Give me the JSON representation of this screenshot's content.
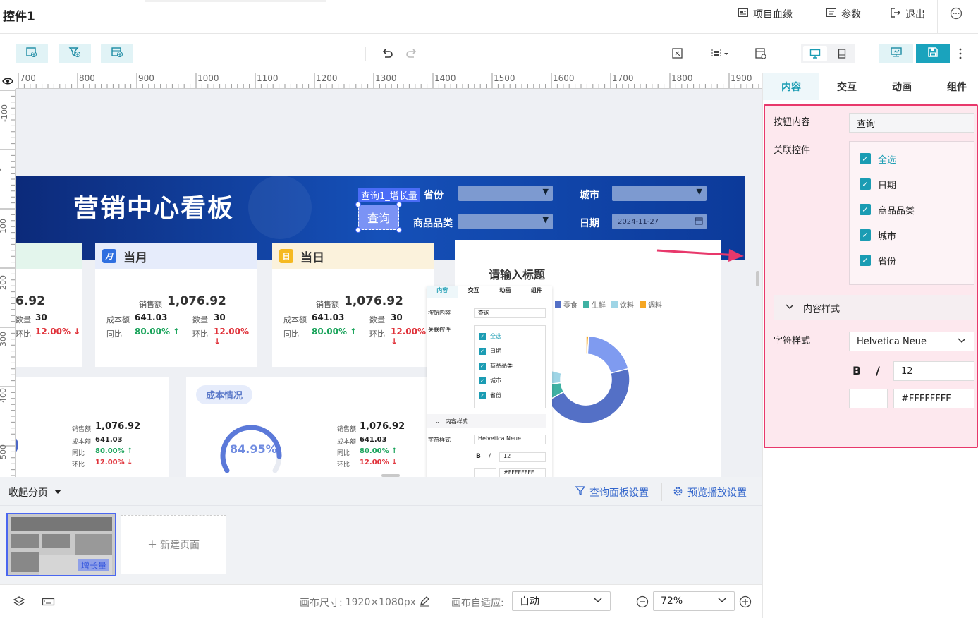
{
  "app": {
    "title": "控件1",
    "actions": {
      "lineage": "项目血缘",
      "params": "参数",
      "exit": "退出"
    }
  },
  "ruler": {
    "top": [
      "700",
      "800",
      "900",
      "1000",
      "1100",
      "1200",
      "1300",
      "1400",
      "1500",
      "1600",
      "1700",
      "1800",
      "1900"
    ],
    "left": [
      "-100",
      "0",
      "100",
      "200",
      "300",
      "400",
      "500"
    ]
  },
  "dashboard": {
    "title": "营销中心看板",
    "selection_label": "查询1_增长量",
    "query_button": "查询",
    "filters": {
      "province": "省份",
      "city": "城市",
      "category": "商品品类",
      "date": "日期",
      "date_value": "2024-11-27"
    },
    "card_partial": {
      "sales": "6.92",
      "qty_label": "数量",
      "qty": "30",
      "hb_label": "环比",
      "hb": "12.00%"
    },
    "card_month": {
      "title": "当月",
      "icon": "月",
      "sales_label": "销售额",
      "sales": "1,076.92",
      "cost_label": "成本额",
      "cost": "641.03",
      "qty_label": "数量",
      "qty": "30",
      "tb_label": "同比",
      "tb": "80.00%",
      "hb_label": "环比",
      "hb": "12.00%"
    },
    "card_day": {
      "title": "当日",
      "icon": "日",
      "sales_label": "销售额",
      "sales": "1,076.92",
      "cost_label": "成本额",
      "cost": "641.03",
      "qty_label": "数量",
      "qty": "30",
      "tb_label": "同比",
      "tb": "80.00%",
      "hb_label": "环比",
      "hb": "12.00%"
    },
    "small_left": {
      "sales_label": "销售额",
      "sales": "1,076.92",
      "cost_label": "成本额",
      "cost": "641.03",
      "tb_label": "同比",
      "tb": "80.00%",
      "hb_label": "环比",
      "hb": "12.00%"
    },
    "cost_card": {
      "badge": "成本情况",
      "gauge": "84.95%",
      "sales_label": "销售额",
      "sales": "1,076.92",
      "cost_label": "成本额",
      "cost": "641.03",
      "tb_label": "同比",
      "tb": "80.00%",
      "hb_label": "环比",
      "hb": "12.00%"
    },
    "chart_card": {
      "title": "请输入标题",
      "legend": [
        "零食",
        "生鲜",
        "饮料",
        "调料"
      ]
    }
  },
  "chart_data": {
    "type": "pie",
    "title": "请输入标题",
    "categories": [
      "零食",
      "生鲜",
      "饮料",
      "调料"
    ],
    "values": [
      0.62,
      0.06,
      0.06,
      0.01
    ],
    "colors": [
      "#5470c6",
      "#3fb1a3",
      "#9fd5e6",
      "#f5a623"
    ]
  },
  "mini_panel": {
    "tabs": [
      "内容",
      "交互",
      "动画",
      "组件"
    ],
    "btn_label": "按钮内容",
    "btn_value": "查询",
    "link_label": "关联控件",
    "items": [
      "全选",
      "日期",
      "商品品类",
      "城市",
      "省份"
    ],
    "style_section": "内容样式",
    "font_label": "字符样式",
    "font": "Helvetica Neue",
    "bold": "B",
    "italic": "/",
    "size": "12",
    "color": "#FFFFFFFF"
  },
  "right_panel": {
    "tabs": [
      "内容",
      "交互",
      "动画",
      "组件"
    ],
    "button_content_label": "按钮内容",
    "button_content_value": "查询",
    "linked_label": "关联控件",
    "linked_items": [
      "全选",
      "日期",
      "商品品类",
      "城市",
      "省份"
    ],
    "style_section": "内容样式",
    "font_label": "字符样式",
    "font_value": "Helvetica Neue",
    "bold": "B",
    "italic": "/",
    "font_size": "12",
    "color_value": "#FFFFFFFF"
  },
  "pager": {
    "collapse": "收起分页",
    "query_settings": "查询面板设置",
    "preview_settings": "预览播放设置",
    "thumb_label": "增长量",
    "new_page": "新建页面"
  },
  "bottom": {
    "canvas_size_label": "画布尺寸:",
    "canvas_size": "1920×1080px",
    "adapt_label": "画布自适应:",
    "adapt_value": "自动",
    "zoom": "72%"
  }
}
